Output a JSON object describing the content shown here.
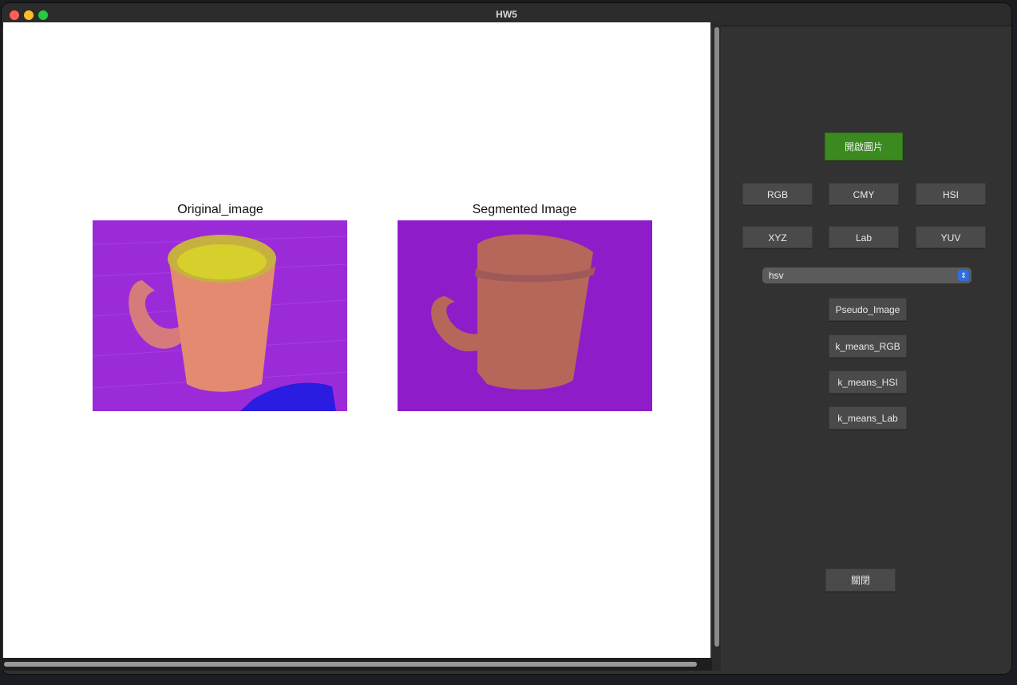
{
  "window": {
    "title": "HW5"
  },
  "figure": {
    "left_title": "Original_image",
    "right_title": "Segmented Image"
  },
  "controls": {
    "open_image": "開啟圖片",
    "color_spaces": [
      "RGB",
      "CMY",
      "HSI",
      "XYZ",
      "Lab",
      "YUV"
    ],
    "colormap_select": {
      "value": "hsv"
    },
    "actions": [
      "Pseudo_Image",
      "k_means_RGB",
      "k_means_HSI",
      "k_means_Lab"
    ],
    "close": "關閉"
  },
  "colors": {
    "background_purple": "#8f1cc9",
    "mug_orange": "#b6675a",
    "accent_green": "#3a8a20"
  }
}
